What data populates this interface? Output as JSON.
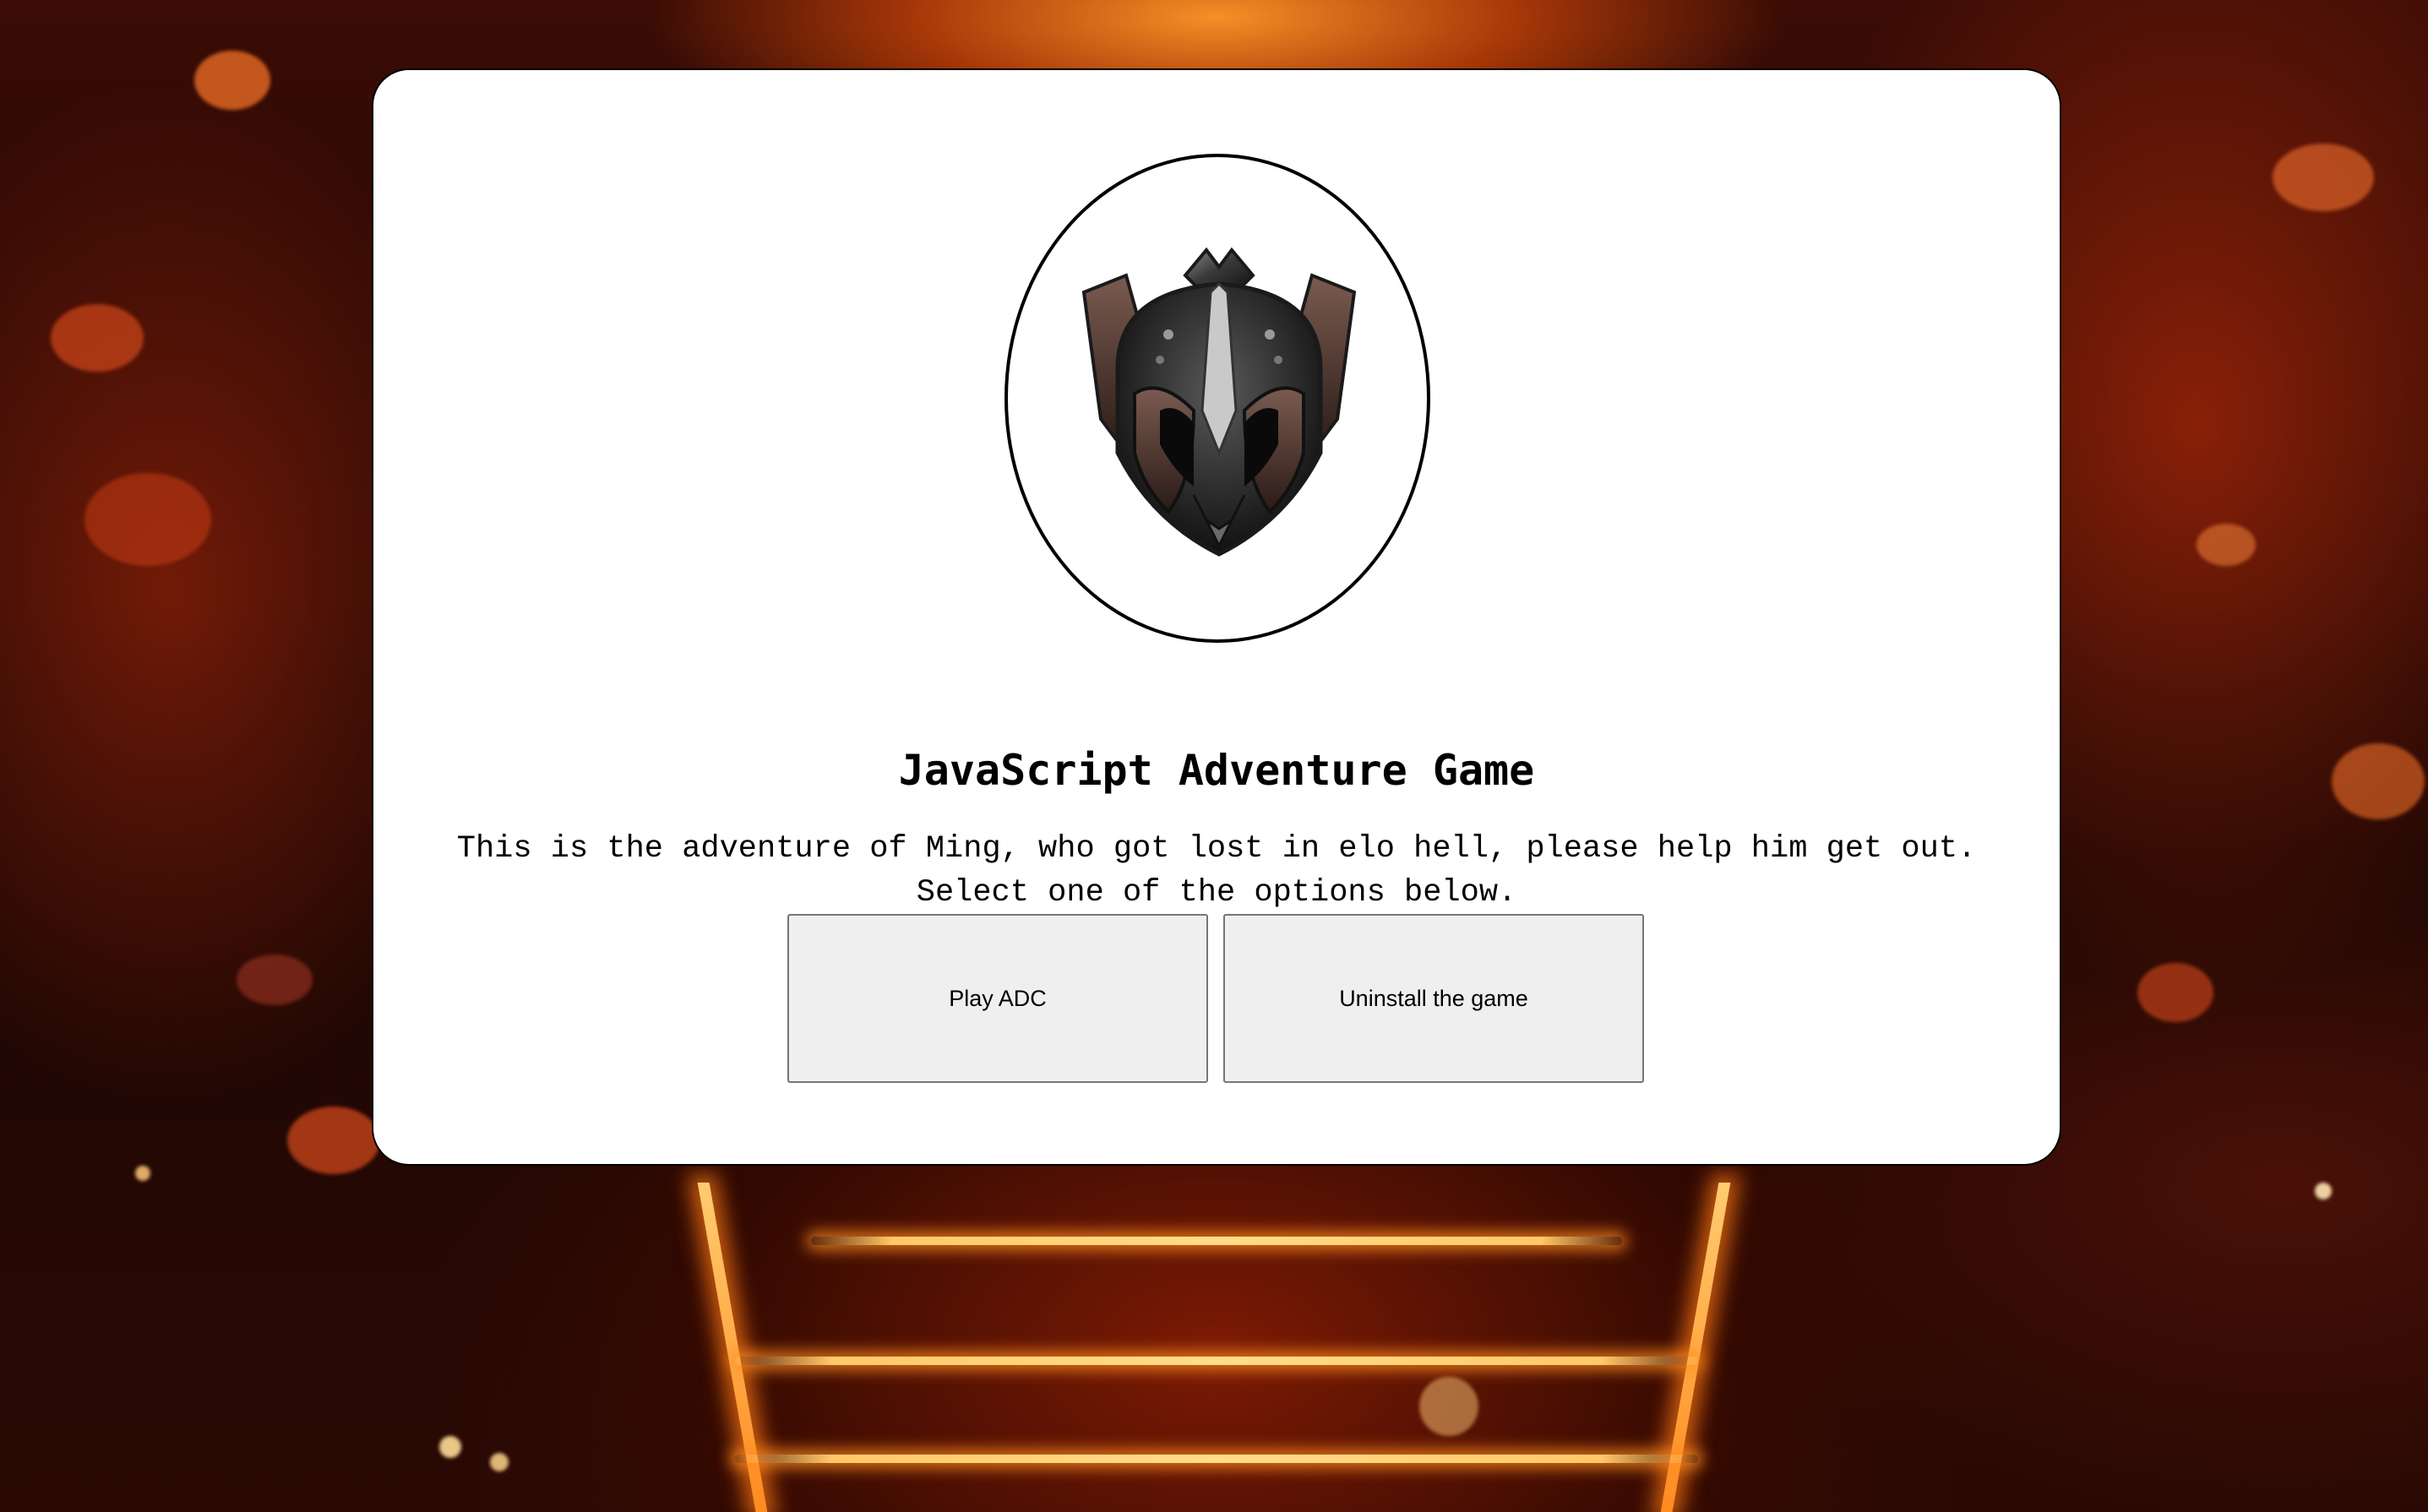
{
  "game": {
    "title": "JavaScript Adventure Game",
    "description_line1": "This is the adventure of Ming, who got lost in elo hell, please help him get out.",
    "description_line2": "Select one of the options below.",
    "emblem_icon": "iron-rank-helmet-emblem"
  },
  "options": [
    {
      "label": "Play ADC"
    },
    {
      "label": "Uninstall the game"
    }
  ],
  "colors": {
    "card_background": "#ffffff",
    "button_background": "#efefef",
    "button_border": "#767676",
    "fire_accent": "#ff7a1a"
  }
}
